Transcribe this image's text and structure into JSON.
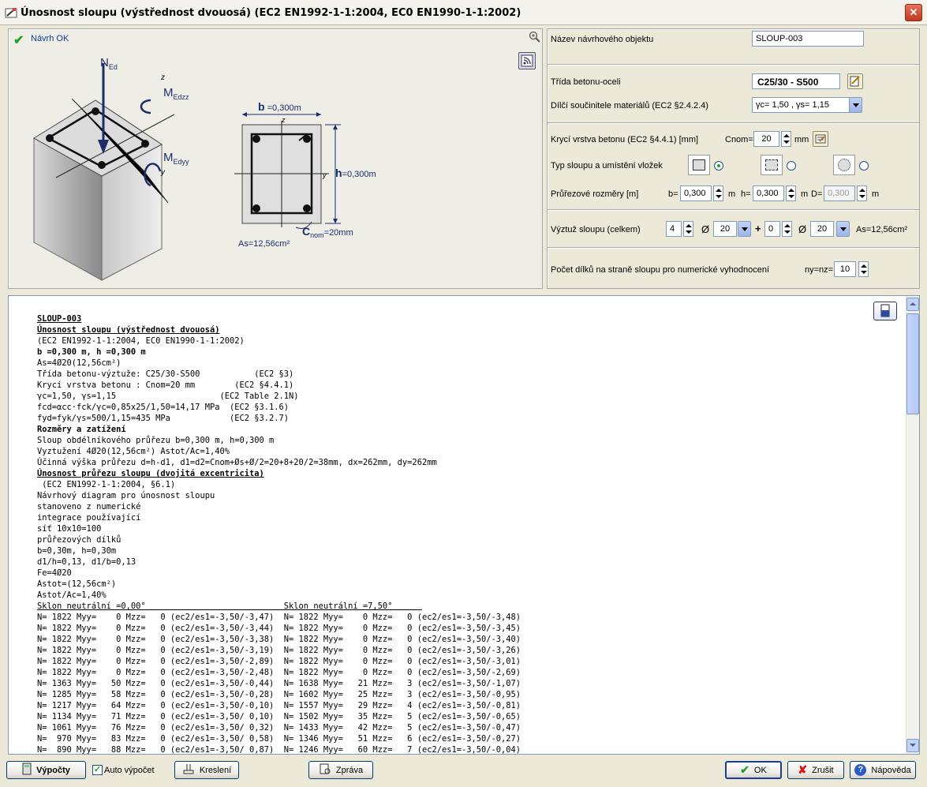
{
  "window": {
    "title": "Únosnost sloupu (výstřednost dvouosá) (EC2 EN1992-1-1:2004, EC0 EN1990-1-1:2002)",
    "close": "✕"
  },
  "diagram": {
    "status": "Návrh OK",
    "ned": "N",
    "ned_sub": "Ed",
    "medzz": "M",
    "medzz_sub": "Edzz",
    "medyy": "M",
    "medyy_sub": "Edyy",
    "axis_z": "z",
    "axis_y": "y",
    "b_label": "b",
    "b_value": "=0,300m",
    "h_label": "h",
    "h_value": "=0,300m",
    "c_label": "C",
    "c_sub": "nom",
    "c_value": "=20mm",
    "as_value": "As=12,56cm²"
  },
  "props": {
    "object_name_label": "Název návrhového objektu",
    "object_name": "SLOUP-003",
    "class_label": "Třída betonu-oceli",
    "class_value": "C25/30 - S500",
    "factors_label": "Dílčí součinitele materiálů (EC2 §2.4.2.4)",
    "factors_value": "γc= 1,50 , γs= 1,15",
    "cover_label": "Krycí vrstva betonu (EC2 §4.4.1) [mm]",
    "cnom_label": "Cnom=",
    "cnom_value": "20",
    "mm": "mm",
    "type_label": "Typ sloupu a umístění vložek",
    "dims_label": "Průřezové rozměry [m]",
    "b_label": "b=",
    "b_value": "0,300",
    "h_label": "h=",
    "h_value": "0,300",
    "d_label": "D=",
    "d_value": "0,300",
    "m": "m",
    "rebar_label": "Výztuž sloupu (celkem)",
    "n1": "4",
    "dia_sym": "Ø",
    "d1": "20",
    "plus": "+",
    "n2": "0",
    "d2": "20",
    "as_label": "As=12,56cm²",
    "divisions_label": "Počet dílků na straně sloupu pro numerické vyhodnocení",
    "nynz_label": "ny=nz=",
    "nynz_value": "10"
  },
  "report": {
    "lines": [
      {
        "t": "SLOUP-003",
        "s": "b u"
      },
      {
        "t": "Únosnost sloupu (výstřednost dvouosá)",
        "s": "b u"
      },
      {
        "t": "(EC2 EN1992-1-1:2004, EC0 EN1990-1-1:2002)",
        "s": ""
      },
      {
        "t": "b =0,300 m, h =0,300 m",
        "s": "b"
      },
      {
        "t": "As=4Ø20(12,56cm²)",
        "s": ""
      },
      {
        "t": "Třída betonu-výztuže: C25/30-S500           (EC2 §3)",
        "s": ""
      },
      {
        "t": "Krycí vrstva betonu : Cnom=20 mm        (EC2 §4.4.1)",
        "s": ""
      },
      {
        "t": "γc=1,50, γs=1,15                     (EC2 Table 2.1N)",
        "s": ""
      },
      {
        "t": "fcd=αcc·fck/γc=0,85x25/1,50=14,17 MPa  (EC2 §3.1.6)",
        "s": ""
      },
      {
        "t": "fyd=fyk/γs=500/1,15=435 MPa            (EC2 §3.2.7)",
        "s": ""
      },
      {
        "t": "Rozměry a zatížení",
        "s": "b"
      },
      {
        "t": "Sloup obdélníkového průřezu b=0,300 m, h=0,300 m",
        "s": ""
      },
      {
        "t": "Vyztužení 4Ø20(12,56cm²) Astot/Ac=1,40%",
        "s": ""
      },
      {
        "t": "Účinná výška průřezu d=h-d1, d1=d2=Cnom+Øs+Ø/2=20+8+20/2=38mm, dx=262mm, dy=262mm",
        "s": ""
      },
      {
        "t": "Únosnost průřezu sloupu (dvojitá excentricita)",
        "s": "b u"
      },
      {
        "t": " (EC2 EN1992-1-1:2004, §6.1)",
        "s": ""
      },
      {
        "t": "Návrhový diagram pro únosnost sloupu",
        "s": ""
      },
      {
        "t": "stanoveno z numerické",
        "s": ""
      },
      {
        "t": "integrace používající",
        "s": ""
      },
      {
        "t": "síť 10x10=100",
        "s": ""
      },
      {
        "t": "průřezových dílků",
        "s": ""
      },
      {
        "t": "b=0,30m, h=0,30m",
        "s": ""
      },
      {
        "t": "d1/h=0,13, d1/b=0,13",
        "s": ""
      },
      {
        "t": "Fe=4Ø20",
        "s": ""
      },
      {
        "t": "Astot=(12,56cm²)",
        "s": ""
      },
      {
        "t": "Astot/Ac=1,40%",
        "s": ""
      },
      {
        "t": "Sklon neutrální =0,00°                            Sklon neutrální =7,50°      ",
        "s": "u"
      },
      {
        "t": "N= 1822 Myy=    0 Mzz=   0 (ec2/es1=-3,50/-3,47)  N= 1822 Myy=    0 Mzz=   0 (ec2/es1=-3,50/-3,48)",
        "s": ""
      },
      {
        "t": "N= 1822 Myy=    0 Mzz=   0 (ec2/es1=-3,50/-3,44)  N= 1822 Myy=    0 Mzz=   0 (ec2/es1=-3,50/-3,45)",
        "s": ""
      },
      {
        "t": "N= 1822 Myy=    0 Mzz=   0 (ec2/es1=-3,50/-3,38)  N= 1822 Myy=    0 Mzz=   0 (ec2/es1=-3,50/-3,40)",
        "s": ""
      },
      {
        "t": "N= 1822 Myy=    0 Mzz=   0 (ec2/es1=-3,50/-3,19)  N= 1822 Myy=    0 Mzz=   0 (ec2/es1=-3,50/-3,26)",
        "s": ""
      },
      {
        "t": "N= 1822 Myy=    0 Mzz=   0 (ec2/es1=-3,50/-2,89)  N= 1822 Myy=    0 Mzz=   0 (ec2/es1=-3,50/-3,01)",
        "s": ""
      },
      {
        "t": "N= 1822 Myy=    0 Mzz=   0 (ec2/es1=-3,50/-2,48)  N= 1822 Myy=    0 Mzz=   0 (ec2/es1=-3,50/-2,69)",
        "s": ""
      },
      {
        "t": "N= 1363 Myy=   50 Mzz=   0 (ec2/es1=-3,50/-0,44)  N= 1638 Myy=   21 Mzz=   3 (ec2/es1=-3,50/-1,07)",
        "s": ""
      },
      {
        "t": "N= 1285 Myy=   58 Mzz=   0 (ec2/es1=-3,50/-0,28)  N= 1602 Myy=   25 Mzz=   3 (ec2/es1=-3,50/-0,95)",
        "s": ""
      },
      {
        "t": "N= 1217 Myy=   64 Mzz=   0 (ec2/es1=-3,50/-0,10)  N= 1557 Myy=   29 Mzz=   4 (ec2/es1=-3,50/-0,81)",
        "s": ""
      },
      {
        "t": "N= 1134 Myy=   71 Mzz=   0 (ec2/es1=-3,50/ 0,10)  N= 1502 Myy=   35 Mzz=   5 (ec2/es1=-3,50/-0,65)",
        "s": ""
      },
      {
        "t": "N= 1061 Myy=   76 Mzz=   0 (ec2/es1=-3,50/ 0,32)  N= 1433 Myy=   42 Mzz=   5 (ec2/es1=-3,50/-0,47)",
        "s": ""
      },
      {
        "t": "N=  970 Myy=   83 Mzz=   0 (ec2/es1=-3,50/ 0,58)  N= 1346 Myy=   51 Mzz=   6 (ec2/es1=-3,50/-0,27)",
        "s": ""
      },
      {
        "t": "N=  890 Myy=   88 Mzz=   0 (ec2/es1=-3,50/ 0,87)  N= 1246 Myy=   60 Mzz=   7 (ec2/es1=-3,50/-0,04)",
        "s": ""
      }
    ]
  },
  "buttons": {
    "calc": "Výpočty",
    "auto": "Auto výpočet",
    "draw": "Kreslení",
    "report": "Zpráva",
    "ok": "OK",
    "cancel": "Zrušit",
    "help": "Nápověda"
  }
}
